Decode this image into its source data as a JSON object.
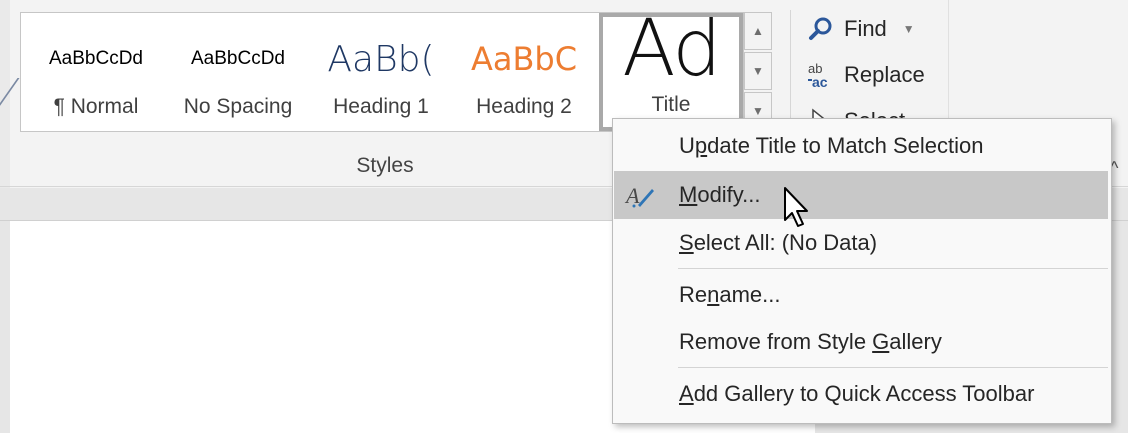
{
  "styles_gallery": {
    "tiles": [
      {
        "preview": "AaBbCcDd",
        "label": "¶ Normal"
      },
      {
        "preview": "AaBbCcDd",
        "label": "No Spacing"
      },
      {
        "preview": "AaBb(",
        "label": "Heading 1"
      },
      {
        "preview": "AaBbC",
        "label": "Heading 2"
      },
      {
        "preview": "Ad",
        "label": "Title"
      }
    ],
    "group_label": "Styles",
    "selected": "Title"
  },
  "editing": {
    "find_label": "Find",
    "replace_label": "Replace",
    "select_label": "Select"
  },
  "context_menu": {
    "items": [
      {
        "pre": "U",
        "ul": "p",
        "post": "date Title to Match Selection"
      },
      {
        "pre": "",
        "ul": "M",
        "post": "odify..."
      },
      {
        "pre": "",
        "ul": "S",
        "post": "elect All: (No Data)"
      },
      {
        "pre": "Re",
        "ul": "n",
        "post": "ame..."
      },
      {
        "pre": "Remove from Style ",
        "ul": "G",
        "post": "allery"
      },
      {
        "pre": "",
        "ul": "A",
        "post": "dd Gallery to Quick Access Toolbar"
      }
    ],
    "highlighted": "Modify..."
  },
  "colors": {
    "heading1": "#1f3864",
    "heading2": "#ed7d31",
    "find_icon": "#2b579a",
    "menu_hover": "#c8c8c8"
  },
  "icons": {
    "find": "magnifier-icon",
    "replace": "replace-ab-ac-icon",
    "select": "cursor-icon",
    "modify": "pencil-style-icon"
  }
}
